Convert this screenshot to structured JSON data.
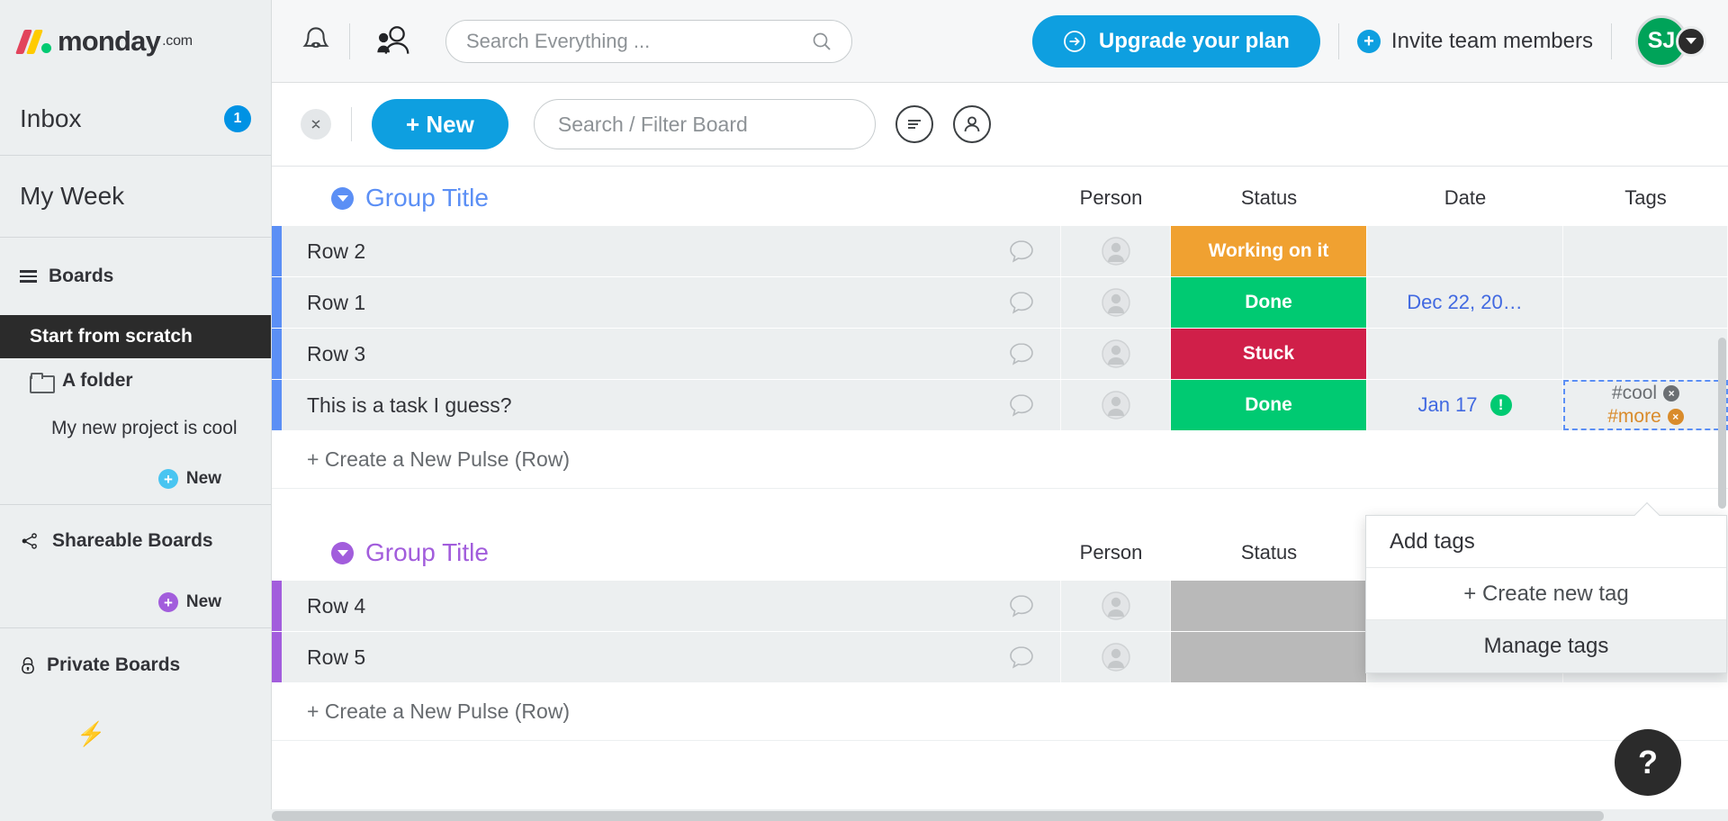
{
  "sidebar": {
    "logo": {
      "name": "monday",
      "suffix": ".com"
    },
    "inbox": {
      "label": "Inbox",
      "badge": "1"
    },
    "my_week": {
      "label": "My Week"
    },
    "boards": {
      "label": "Boards"
    },
    "active_board": "Start from scratch",
    "folder": "A folder",
    "project": "My new project is cool",
    "new_board_label": "New",
    "shareable": {
      "label": "Shareable Boards",
      "new_label": "New"
    },
    "private": {
      "label": "Private Boards"
    }
  },
  "topbar": {
    "search_placeholder": "Search Everything ...",
    "upgrade_label": "Upgrade your plan",
    "invite_label": "Invite team members",
    "avatar_initials": "SJ"
  },
  "boardbar": {
    "new_label": "+ New",
    "filter_placeholder": "Search / Filter Board"
  },
  "columns": {
    "person": "Person",
    "status": "Status",
    "date": "Date",
    "tags": "Tags"
  },
  "groups": [
    {
      "title": "Group Title",
      "color": "#5b8ff5",
      "rows": [
        {
          "name": "Row 2",
          "status": "Working on it",
          "status_color": "#f0a131",
          "date": "",
          "tags": ""
        },
        {
          "name": "Row 1",
          "status": "Done",
          "status_color": "#00ca72",
          "date": "Dec 22, 20…",
          "tags": ""
        },
        {
          "name": "Row 3",
          "status": "Stuck",
          "status_color": "#d01f49",
          "date": "",
          "tags": ""
        },
        {
          "name": "This is a task I guess?",
          "status": "Done",
          "status_color": "#00ca72",
          "date": "Jan 17",
          "tags": "selected"
        }
      ],
      "create_label": "+ Create a New Pulse (Row)"
    },
    {
      "title": "Group Title",
      "color": "#a25ddc",
      "rows": [
        {
          "name": "Row 4",
          "status": "",
          "status_color": "#b9b9b9",
          "date": "",
          "tags": ""
        },
        {
          "name": "Row 5",
          "status": "",
          "status_color": "#b9b9b9",
          "date": "",
          "tags": ""
        }
      ],
      "create_label": "+ Create a New Pulse (Row)"
    }
  ],
  "tags_cell": {
    "tag1": "#cool",
    "tag2": "#more"
  },
  "tags_popup": {
    "add_label": "Add tags",
    "create_label": "+ Create new tag",
    "manage_label": "Manage tags"
  },
  "help": {
    "label": "?"
  },
  "colors": {
    "brand_blue": "#0e9fe0",
    "group_blue": "#5b8ff5",
    "group_purple": "#a25ddc",
    "status_working": "#f0a131",
    "status_done": "#00ca72",
    "status_stuck": "#d01f49",
    "avatar_green": "#00a359"
  }
}
